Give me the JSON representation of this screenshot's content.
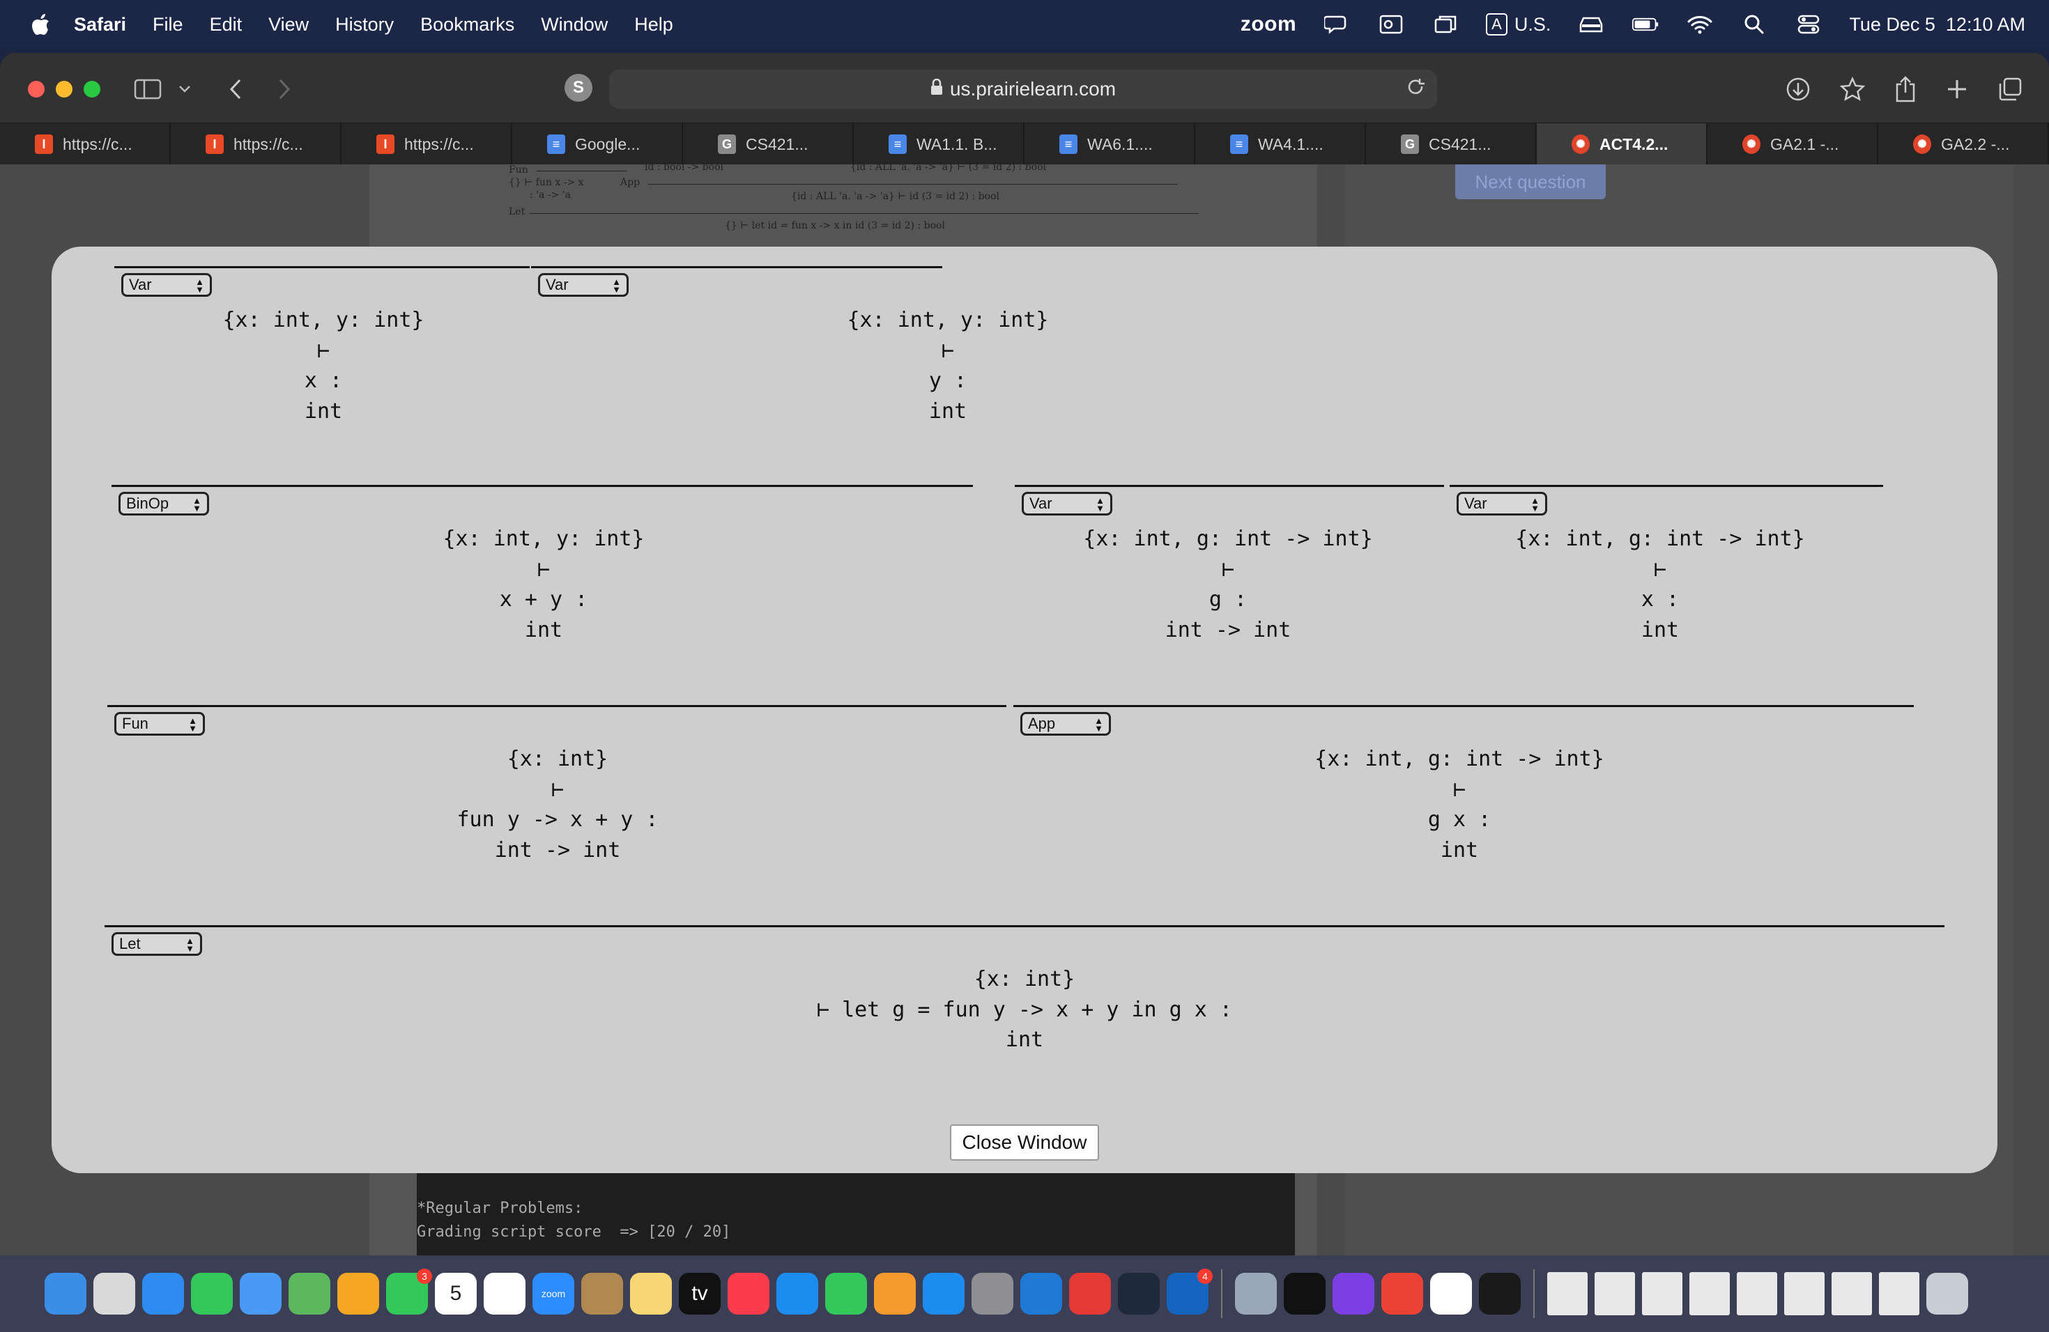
{
  "menubar": {
    "app": "Safari",
    "items": [
      "File",
      "Edit",
      "View",
      "History",
      "Bookmarks",
      "Window",
      "Help"
    ],
    "zoom": "zoom",
    "input_badge": "A",
    "input_lang": "U.S.",
    "datetime": "Tue Dec 5  12:10 AM"
  },
  "browser": {
    "url": "us.prairielearn.com",
    "extension_letter": "S",
    "tabs": [
      {
        "label": "https://c...",
        "icon": "illinois-icon",
        "color": "#e84a27",
        "glyph": "I"
      },
      {
        "label": "https://c...",
        "icon": "illinois-icon",
        "color": "#e84a27",
        "glyph": "I"
      },
      {
        "label": "https://c...",
        "icon": "illinois-icon",
        "color": "#e84a27",
        "glyph": "I"
      },
      {
        "label": "Google...",
        "icon": "google-docs-icon",
        "color": "#4a86e8",
        "glyph": "≡"
      },
      {
        "label": "CS421...",
        "icon": "gradescope-icon",
        "color": "#8a8a8a",
        "glyph": "G"
      },
      {
        "label": "WA1.1. B...",
        "icon": "google-docs-icon",
        "color": "#4a86e8",
        "glyph": "≡"
      },
      {
        "label": "WA6.1....",
        "icon": "google-docs-icon",
        "color": "#4a86e8",
        "glyph": "≡"
      },
      {
        "label": "WA4.1....",
        "icon": "google-docs-icon",
        "color": "#4a86e8",
        "glyph": "≡"
      },
      {
        "label": "CS421...",
        "icon": "gradescope-icon",
        "color": "#8a8a8a",
        "glyph": "G"
      },
      {
        "label": "ACT4.2...",
        "icon": "prairielearn-icon",
        "color": "#e0442a",
        "glyph": "✺",
        "active": true
      },
      {
        "label": "GA2.1 -...",
        "icon": "prairielearn-icon",
        "color": "#e0442a",
        "glyph": "✺"
      },
      {
        "label": "GA2.2 -...",
        "icon": "prairielearn-icon",
        "color": "#e0442a",
        "glyph": "✺"
      }
    ]
  },
  "background_page": {
    "next_question": "Next question",
    "proof_lines": [
      "Fun",
      "id : bool -> bool",
      "{id : ALL 'a. 'a -> 'a} ⊢ (3 = id 2) : bool",
      "{} ⊢ fun x -> x",
      "App",
      ": 'a -> 'a",
      "{id : ALL 'a. 'a -> 'a} ⊢ id (3 = id 2) : bool",
      "Let",
      "{} ⊢ let id = fun x -> x in id (3 = id 2) :   bool"
    ],
    "terminal_lines": [
      "*Regular Problems:",
      "Grading script score  => [20 / 20]"
    ]
  },
  "modal": {
    "close_label": "Close Window",
    "nodes": [
      {
        "rule": "Var",
        "env": "{x: int, y: int}",
        "turnstile": "⊢",
        "expr": "x :",
        "type": "int"
      },
      {
        "rule": "Var",
        "env": "{x: int, y: int}",
        "turnstile": "⊢",
        "expr": "y :",
        "type": "int"
      },
      {
        "rule": "BinOp",
        "env": "{x: int, y: int}",
        "turnstile": "⊢",
        "expr": "x + y :",
        "type": "int"
      },
      {
        "rule": "Var",
        "env": "{x: int, g: int -> int}",
        "turnstile": "⊢",
        "expr": "g :",
        "type": "int -> int"
      },
      {
        "rule": "Var",
        "env": "{x: int, g: int -> int}",
        "turnstile": "⊢",
        "expr": "x :",
        "type": "int"
      },
      {
        "rule": "Fun",
        "env": "{x: int}",
        "turnstile": "⊢",
        "expr": "fun y -> x + y :",
        "type": "int -> int"
      },
      {
        "rule": "App",
        "env": "{x: int, g: int -> int}",
        "turnstile": "⊢",
        "expr": "g x :",
        "type": "int"
      },
      {
        "rule": "Let",
        "env": "{x: int}",
        "turnstile": "⊢",
        "expr": "let g = fun y -> x + y in g x :",
        "type": "int"
      }
    ]
  },
  "dock": {
    "apps": [
      {
        "name": "finder-icon",
        "color": "#3a8ee6"
      },
      {
        "name": "launchpad-icon",
        "color": "#d9d9d9"
      },
      {
        "name": "safari-icon",
        "color": "#2e8bf0"
      },
      {
        "name": "messages-icon",
        "color": "#34c759"
      },
      {
        "name": "mail-icon",
        "color": "#4a9af5"
      },
      {
        "name": "maps-icon",
        "color": "#5cb85c"
      },
      {
        "name": "photos-icon",
        "color": "#f5a623"
      },
      {
        "name": "facetime-icon",
        "color": "#34c759",
        "badge": "3"
      },
      {
        "name": "calendar-icon",
        "color": "#ffffff",
        "text": "5"
      },
      {
        "name": "reminders-icon",
        "color": "#ffffff"
      },
      {
        "name": "zoom-icon",
        "color": "#2d8cff",
        "text": "zoom"
      },
      {
        "name": "contacts-icon",
        "color": "#b08850"
      },
      {
        "name": "notes-icon",
        "color": "#f7d774"
      },
      {
        "name": "appletv-icon",
        "color": "#111111",
        "text": "tv"
      },
      {
        "name": "music-icon",
        "color": "#fa3c4c"
      },
      {
        "name": "keynote-icon",
        "color": "#1c8cf0"
      },
      {
        "name": "numbers-icon",
        "color": "#34c759"
      },
      {
        "name": "pages-icon",
        "color": "#f79a2e"
      },
      {
        "name": "appstore-icon",
        "color": "#1c8cf0"
      },
      {
        "name": "system-settings-icon",
        "color": "#8e8e93"
      },
      {
        "name": "vscode-icon",
        "color": "#1f7ad6"
      },
      {
        "name": "speeko-icon",
        "color": "#e53935"
      },
      {
        "name": "powershell-icon",
        "color": "#1e2a3a"
      },
      {
        "name": "outlook-icon",
        "color": "#1565c0",
        "badge": "4"
      },
      {
        "name": "preview-icon",
        "color": "#9aa7b8"
      },
      {
        "name": "terminal-icon",
        "color": "#111111"
      },
      {
        "name": "intellij-icon",
        "color": "#7b3fe4"
      },
      {
        "name": "chrome-icon",
        "color": "#ea4335"
      },
      {
        "name": "slack-icon",
        "color": "#ffffff"
      },
      {
        "name": "activity-monitor-icon",
        "color": "#1a1a1a"
      }
    ],
    "doc_count": 8,
    "trash": "trash-icon"
  }
}
